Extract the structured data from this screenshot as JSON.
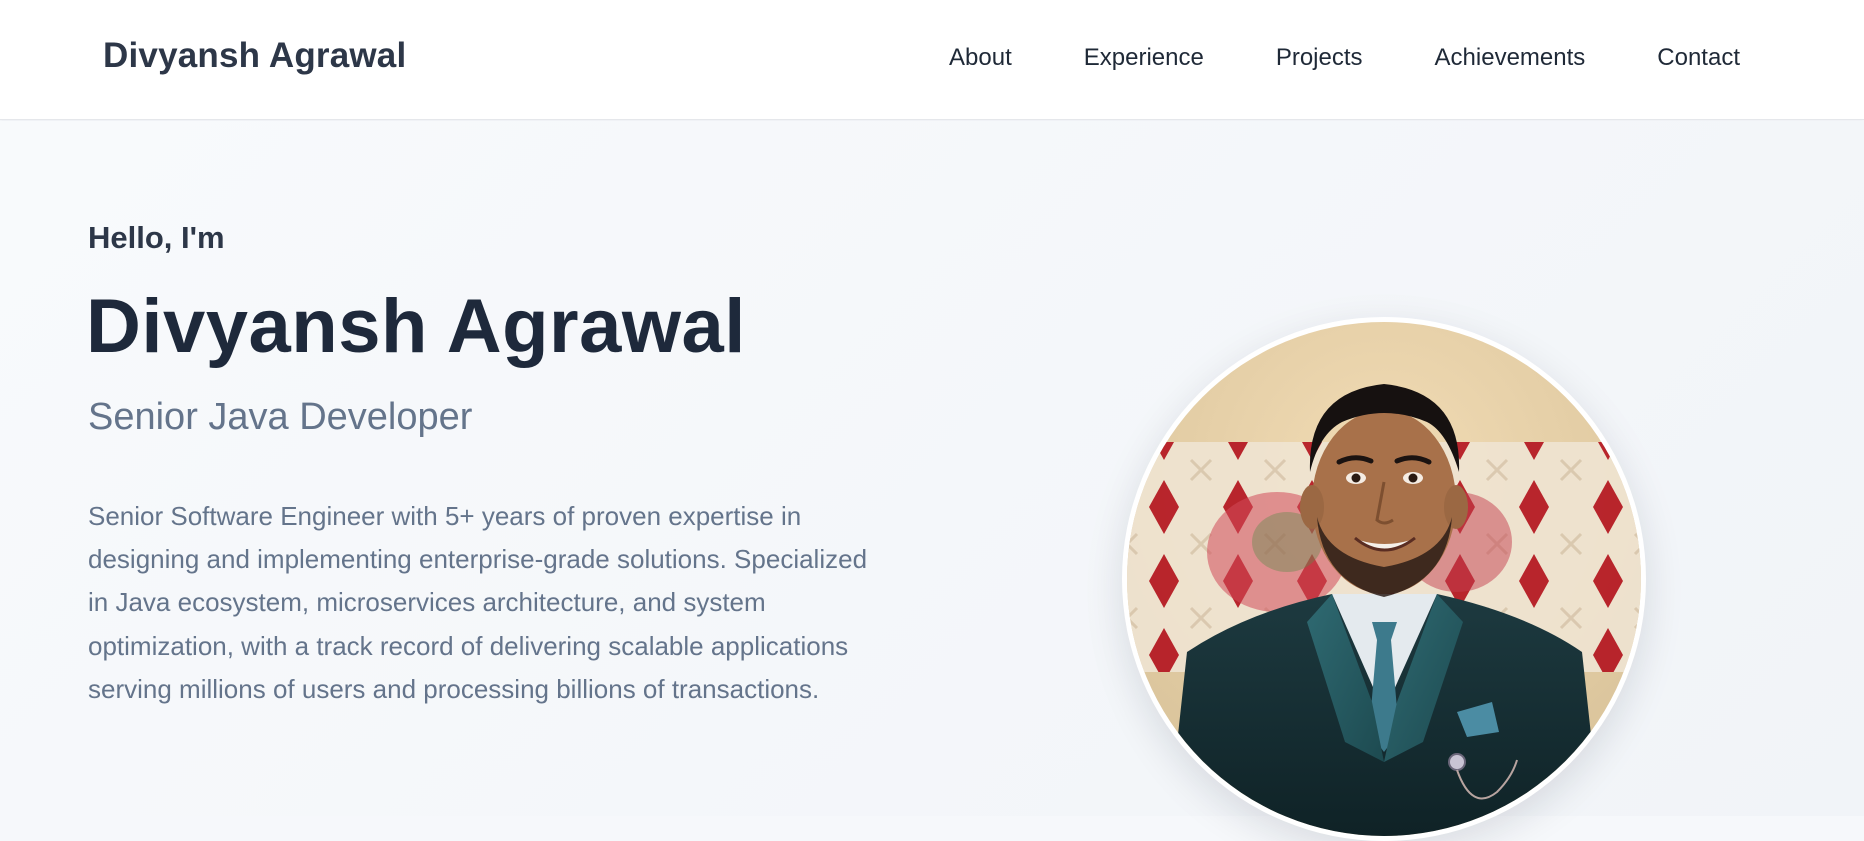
{
  "header": {
    "brand": "Divyansh Agrawal",
    "nav": [
      {
        "label": "About"
      },
      {
        "label": "Experience"
      },
      {
        "label": "Projects"
      },
      {
        "label": "Achievements"
      },
      {
        "label": "Contact"
      }
    ]
  },
  "hero": {
    "greeting": "Hello, I'm",
    "name": "Divyansh Agrawal",
    "role": "Senior Java Developer",
    "description": "Senior Software Engineer with 5+ years of proven expertise in designing and implementing enterprise-grade solutions. Specialized in Java ecosystem, microservices architecture, and system optimization, with a track record of delivering scalable applications serving millions of users and processing billions of transactions."
  },
  "colors": {
    "text_dark": "#1e293b",
    "text_muted": "#64748b",
    "background": "#f6f8fb",
    "nav_background": "#ffffff"
  }
}
